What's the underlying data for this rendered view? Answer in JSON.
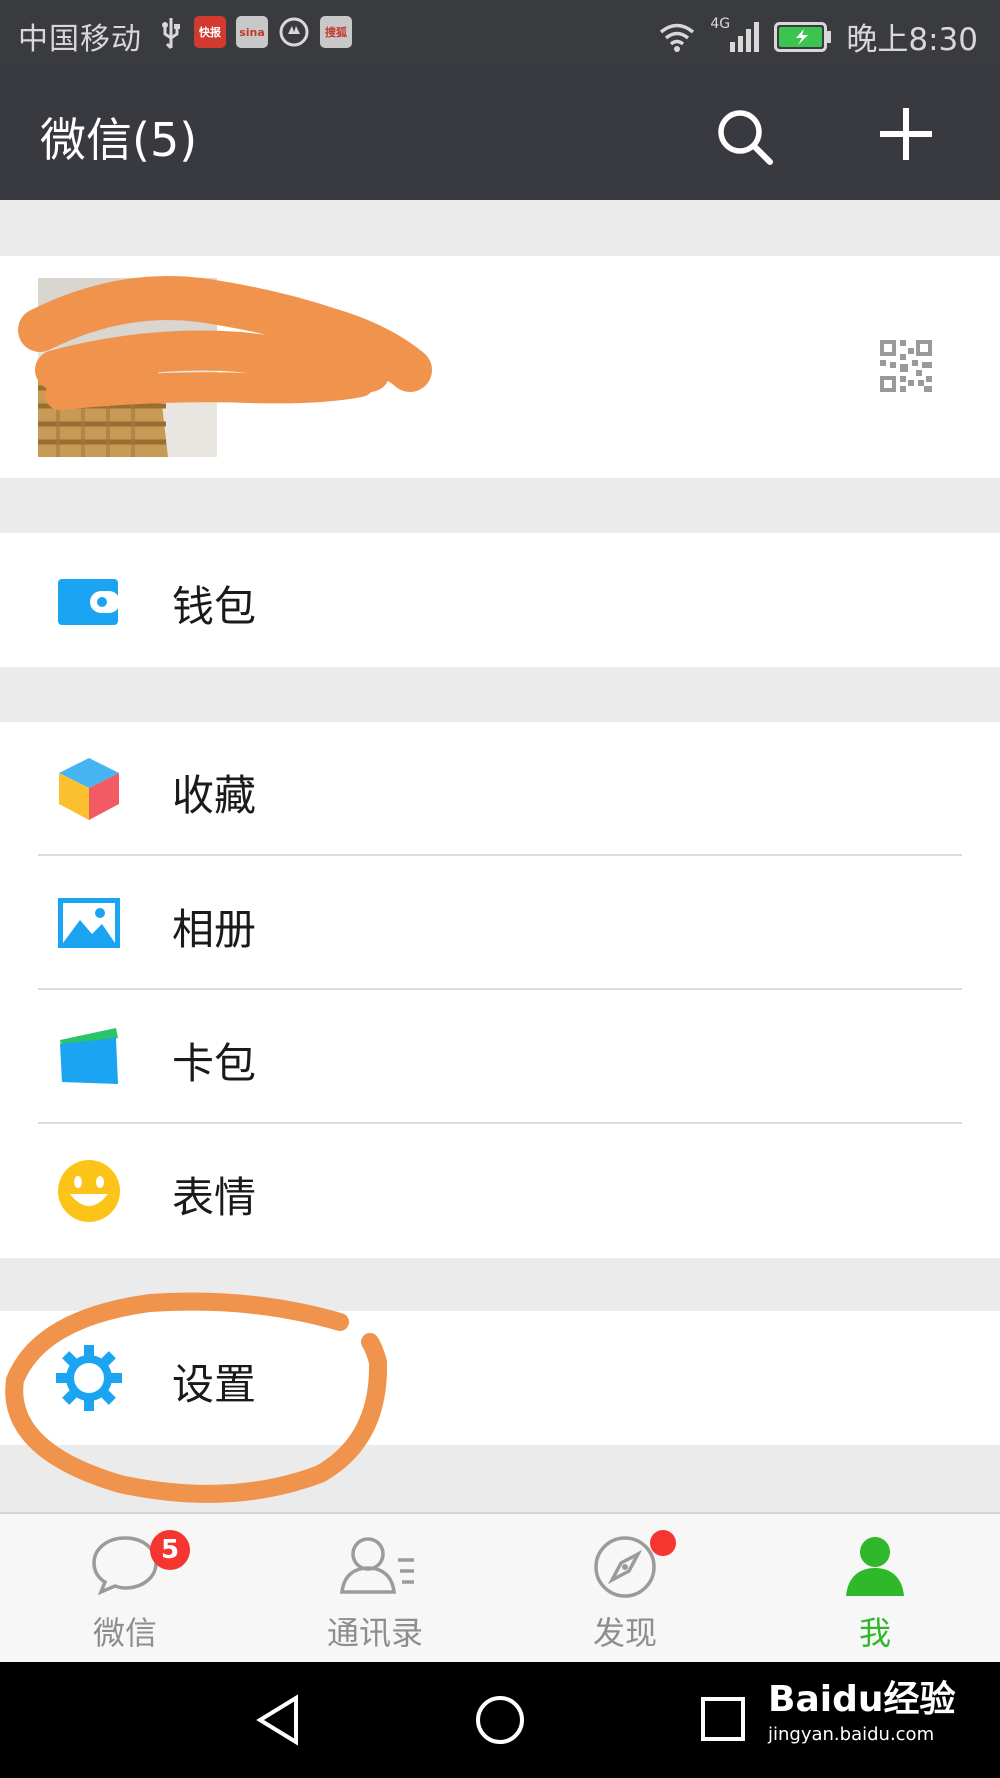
{
  "status_bar": {
    "carrier": "中国移动",
    "time": "晚上8:30",
    "network": "4G",
    "notification_icons": [
      "usb-icon",
      "news-app-icon",
      "sina-app-icon",
      "security-icon",
      "sohu-video-icon"
    ]
  },
  "header": {
    "title": "微信(5)",
    "search_icon": "search-icon",
    "add_icon": "plus-icon"
  },
  "profile": {
    "qr_icon": "qr-code-icon"
  },
  "menu": {
    "wallet": "钱包",
    "favorites": "收藏",
    "album": "相册",
    "cards": "卡包",
    "stickers": "表情",
    "settings": "设置"
  },
  "tabs": [
    {
      "label": "微信",
      "badge": "5"
    },
    {
      "label": "通讯录"
    },
    {
      "label": "发现",
      "has_dot": true
    },
    {
      "label": "我",
      "active": true
    }
  ],
  "watermark": {
    "brand": "Baidu经验",
    "url": "jingyan.baidu.com"
  },
  "colors": {
    "header_bg": "#393a3f",
    "accent_green": "#2fb82a",
    "badge_red": "#f43530",
    "icon_blue": "#1aa4f2",
    "annotation_orange": "#f0944d"
  }
}
